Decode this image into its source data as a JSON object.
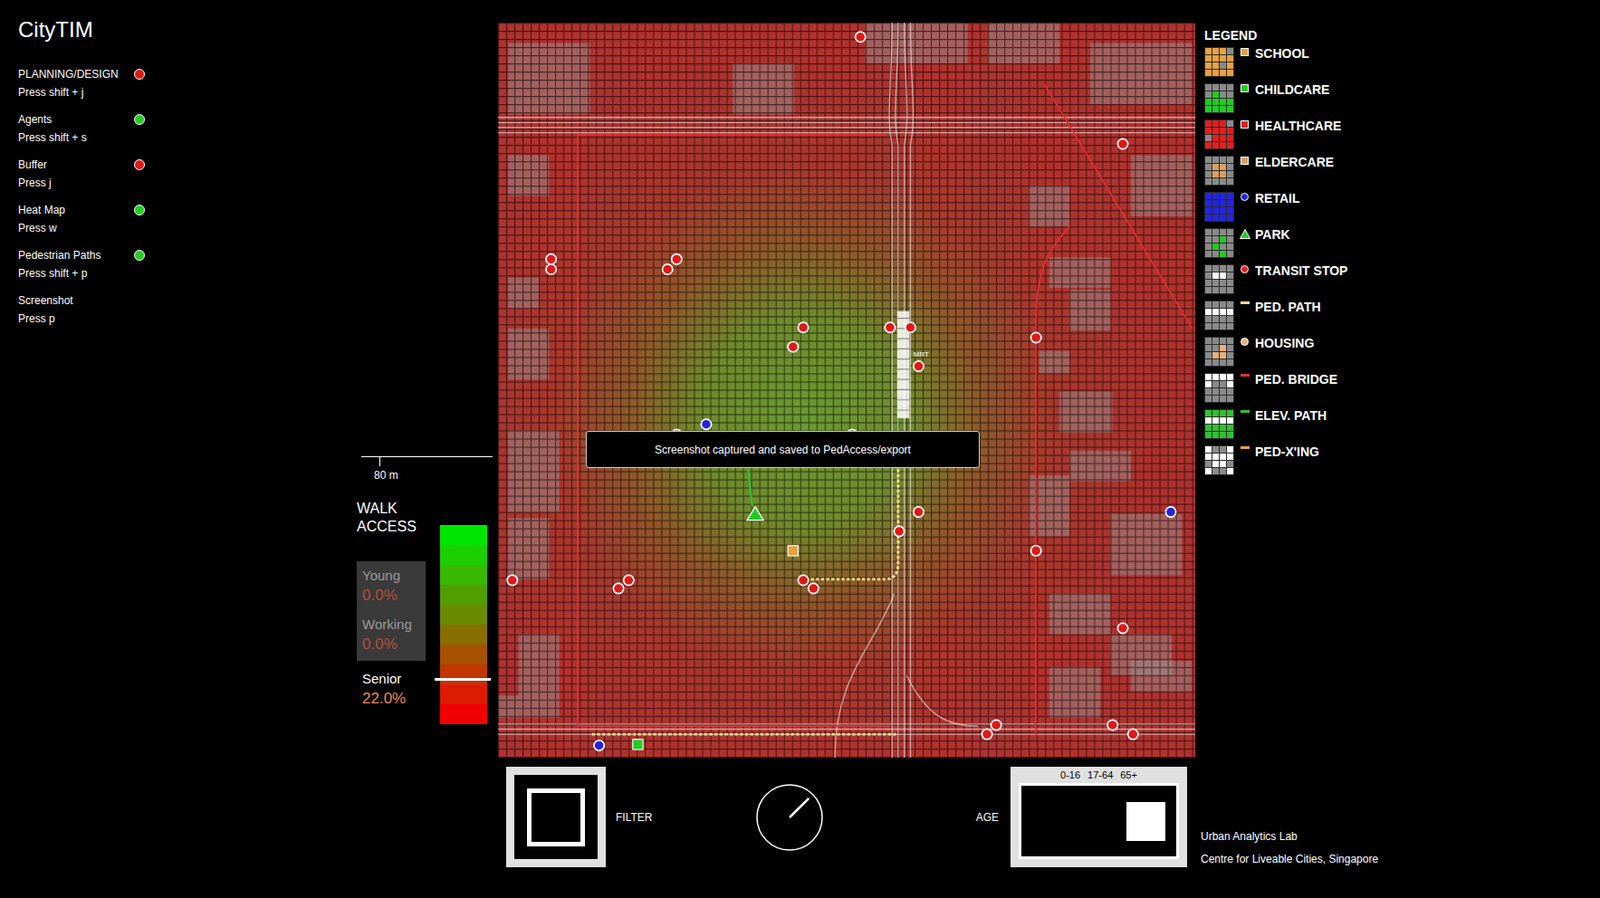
{
  "app": {
    "title": "CityTIM"
  },
  "menu": [
    {
      "label": "PLANNING/DESIGN",
      "hint": "Press shift + j",
      "kind": "toggle",
      "on": false
    },
    {
      "label": "Agents",
      "hint": "Press shift + s",
      "kind": "toggle",
      "on": true
    },
    {
      "label": "Buffer",
      "hint": "Press j",
      "kind": "toggle",
      "on": false
    },
    {
      "label": "Heat Map",
      "hint": "Press w",
      "kind": "toggle",
      "on": true
    },
    {
      "label": "Pedestrian Paths",
      "hint": "Press shift + p",
      "kind": "toggle",
      "on": true
    },
    {
      "label": "Screenshot",
      "hint": "Press p",
      "kind": "action",
      "on": false
    }
  ],
  "walk_access": {
    "scale_label": "80 m",
    "title": "WALK ACCESS",
    "level": 0.22,
    "groups": [
      {
        "name": "Young",
        "value": "0.0%",
        "selected": false
      },
      {
        "name": "Working",
        "value": "0.0%",
        "selected": false
      },
      {
        "name": "Senior",
        "value": "22.0%",
        "selected": true
      }
    ]
  },
  "map": {
    "station_label": "MRT",
    "toast": "Screenshot captured and saved to PedAccess/export"
  },
  "legend": {
    "title": "LEGEND",
    "items": [
      {
        "label": "SCHOOL",
        "color": "#e8a040",
        "kind": "square"
      },
      {
        "label": "CHILDCARE",
        "color": "#22cc22",
        "kind": "square"
      },
      {
        "label": "HEALTHCARE",
        "color": "#e02020",
        "kind": "square"
      },
      {
        "label": "ELDERCARE",
        "color": "#d9a060",
        "kind": "square"
      },
      {
        "label": "RETAIL",
        "color": "#2424e0",
        "kind": "circle"
      },
      {
        "label": "PARK",
        "color": "#22cc22",
        "kind": "triangle"
      },
      {
        "label": "TRANSIT STOP",
        "color": "#e02020",
        "kind": "circle"
      },
      {
        "label": "PED. PATH",
        "color": "#f5e08a",
        "kind": "line"
      },
      {
        "label": "HOUSING",
        "color": "#e8b080",
        "kind": "circle"
      },
      {
        "label": "PED. BRIDGE",
        "color": "#e03030",
        "kind": "line"
      },
      {
        "label": "ELEV. PATH",
        "color": "#30c030",
        "kind": "line"
      },
      {
        "label": "PED-X'ING",
        "color": "#f0a040",
        "kind": "line"
      }
    ]
  },
  "controls": {
    "filter_label": "FILTER",
    "dial": {
      "level": 0.125
    },
    "age": {
      "label": "AGE",
      "options": [
        {
          "label": "0-16",
          "selected": false
        },
        {
          "label": "17-64",
          "selected": false
        },
        {
          "label": "65+",
          "selected": true
        }
      ]
    }
  },
  "credits": [
    "Urban Analytics Lab",
    "Centre for Liveable Cities, Singapore"
  ]
}
